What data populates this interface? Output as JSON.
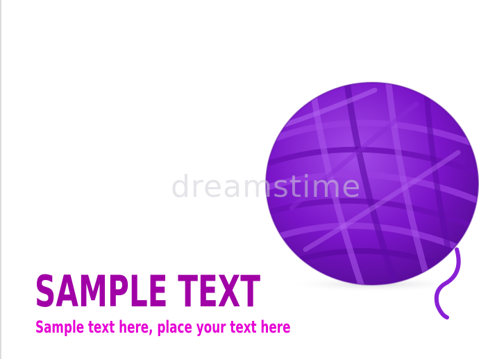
{
  "image": {
    "subject": "purple yarn ball",
    "colors": {
      "yarn_base": "#7a14c8",
      "yarn_highlight": "#a24be8",
      "yarn_shadow": "#4e0a8c",
      "headline": "#a000a6",
      "subline": "#e600d4",
      "watermark": "#cdcdd7"
    }
  },
  "watermark": {
    "text": "dreamstime"
  },
  "headline": {
    "text": "SAMPLE TEXT"
  },
  "subline": {
    "text": "Sample text here, place your text here"
  }
}
